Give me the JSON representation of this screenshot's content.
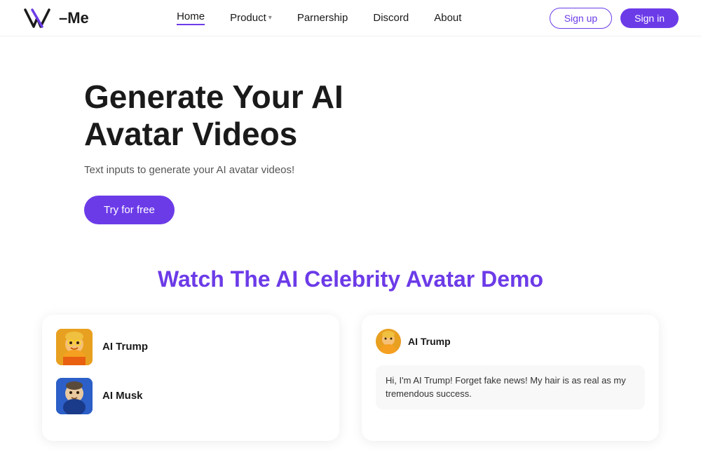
{
  "nav": {
    "logo_text": "–Me",
    "links": [
      {
        "label": "Home",
        "active": true,
        "has_dropdown": false
      },
      {
        "label": "Product",
        "active": false,
        "has_dropdown": true
      },
      {
        "label": "Parnership",
        "active": false,
        "has_dropdown": false
      },
      {
        "label": "Discord",
        "active": false,
        "has_dropdown": false
      },
      {
        "label": "About",
        "active": false,
        "has_dropdown": false
      }
    ],
    "btn_signup": "Sign up",
    "btn_signin": "Sign in"
  },
  "hero": {
    "title_line1": "Generate Your AI",
    "title_line2": "Avatar Videos",
    "subtitle": "Text inputs to generate your AI avatar videos!",
    "cta": "Try for free"
  },
  "demo": {
    "section_title": "Watch The AI Celebrity Avatar Demo",
    "avatars": [
      {
        "name": "AI Trump",
        "color1": "#f5a623",
        "color2": "#e55b1a"
      },
      {
        "name": "AI Musk",
        "color1": "#4a90d9",
        "color2": "#2c5fc7"
      }
    ],
    "chat": {
      "speaker": "AI Trump",
      "message": "Hi, I'm AI Trump! Forget fake news! My hair is as real as my tremendous success."
    }
  }
}
